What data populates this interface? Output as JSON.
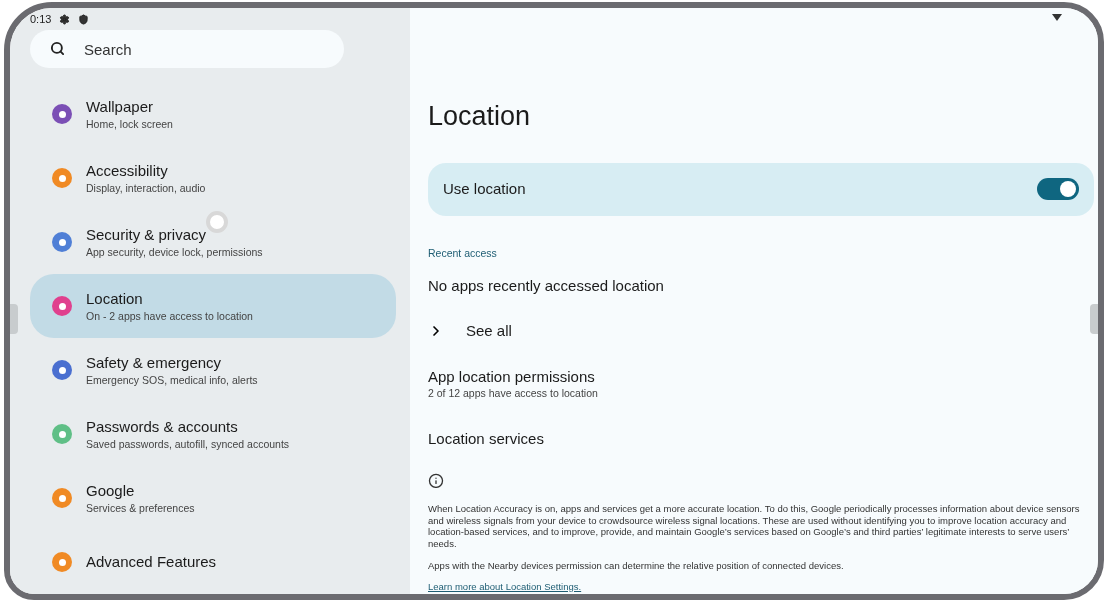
{
  "status_bar": {
    "time": "0:13"
  },
  "search": {
    "placeholder": "Search"
  },
  "sidebar": {
    "items": [
      {
        "title": "Wallpaper",
        "subtitle": "Home, lock screen",
        "color": "#7b4fb5",
        "selected": false
      },
      {
        "title": "Accessibility",
        "subtitle": "Display, interaction, audio",
        "color": "#f08a24",
        "selected": false
      },
      {
        "title": "Security & privacy",
        "subtitle": "App security, device lock, permissions",
        "color": "#4f7fd6",
        "selected": false
      },
      {
        "title": "Location",
        "subtitle": "On - 2 apps have access to location",
        "color": "#e0408e",
        "selected": true
      },
      {
        "title": "Safety & emergency",
        "subtitle": "Emergency SOS, medical info, alerts",
        "color": "#4a6fd0",
        "selected": false
      },
      {
        "title": "Passwords & accounts",
        "subtitle": "Saved passwords, autofill, synced accounts",
        "color": "#5fbf86",
        "selected": false
      },
      {
        "title": "Google",
        "subtitle": "Services & preferences",
        "color": "#f08a24",
        "selected": false
      },
      {
        "title": "Advanced Features",
        "color": "#f08a24",
        "selected": false
      }
    ]
  },
  "page": {
    "title": "Location",
    "use_location": {
      "label": "Use location",
      "on": true
    },
    "section_header": "Recent access",
    "recent_text": "No apps recently accessed location",
    "see_all": "See all",
    "permissions": {
      "title": "App location permissions",
      "subtitle": "2 of 12 apps have access to location"
    },
    "services": "Location services",
    "paragraphs": [
      "When Location Accuracy is on, apps and services get a more accurate location. To do this, Google periodically processes information about device sensors and wireless signals from your device to crowdsource wireless signal locations. These are used without identifying you to improve location accuracy and location-based services, and to improve, provide, and maintain Google’s services based on Google’s and third parties’ legitimate interests to serve users’ needs.",
      "Apps with the Nearby devices permission can determine the relative position of connected devices."
    ],
    "link": "Learn more about Location Settings."
  }
}
